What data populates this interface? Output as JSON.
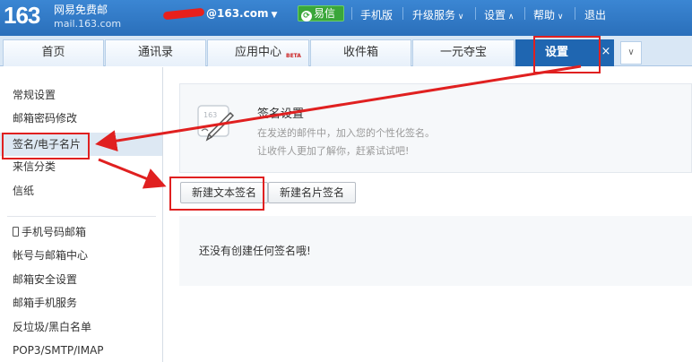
{
  "header": {
    "logo": "163",
    "brand_name": "网易免费邮",
    "brand_domain": "mail.163.com",
    "account_suffix": "@163.com",
    "yixin_label": "易信",
    "links": [
      {
        "label": "手机版"
      },
      {
        "label": "升级服务"
      },
      {
        "label": "设置"
      },
      {
        "label": "帮助"
      },
      {
        "label": "退出"
      }
    ]
  },
  "tabs": [
    {
      "label": "首页"
    },
    {
      "label": "通讯录"
    },
    {
      "label": "应用中心",
      "badge": "BETA"
    },
    {
      "label": "收件箱"
    },
    {
      "label": "一元夺宝"
    },
    {
      "label": "设置",
      "active": true
    }
  ],
  "tab_close_label": "×",
  "sidebar": {
    "group1": [
      "常规设置",
      "邮箱密码修改",
      "签名/电子名片",
      "来信分类",
      "信纸"
    ],
    "group2": [
      "手机号码邮箱",
      "帐号与邮箱中心",
      "邮箱安全设置",
      "邮箱手机服务",
      "反垃圾/黑白名单",
      "POP3/SMTP/IMAP"
    ]
  },
  "main": {
    "intro_title": "签名设置",
    "intro_desc_1": "在发送的邮件中，加入您的个性化签名。",
    "intro_desc_2": "让收件人更加了解你，赶紧试试吧!",
    "icon_label": "163",
    "btn_text_sig": "新建文本签名",
    "btn_card_sig": "新建名片签名",
    "empty_text": "还没有创建任何签名哦!"
  },
  "colors": {
    "header_blue": "#2f79c6",
    "active_tab": "#1f66b1",
    "annotation_red": "#e02020",
    "yixin_green": "#3aa63a"
  }
}
